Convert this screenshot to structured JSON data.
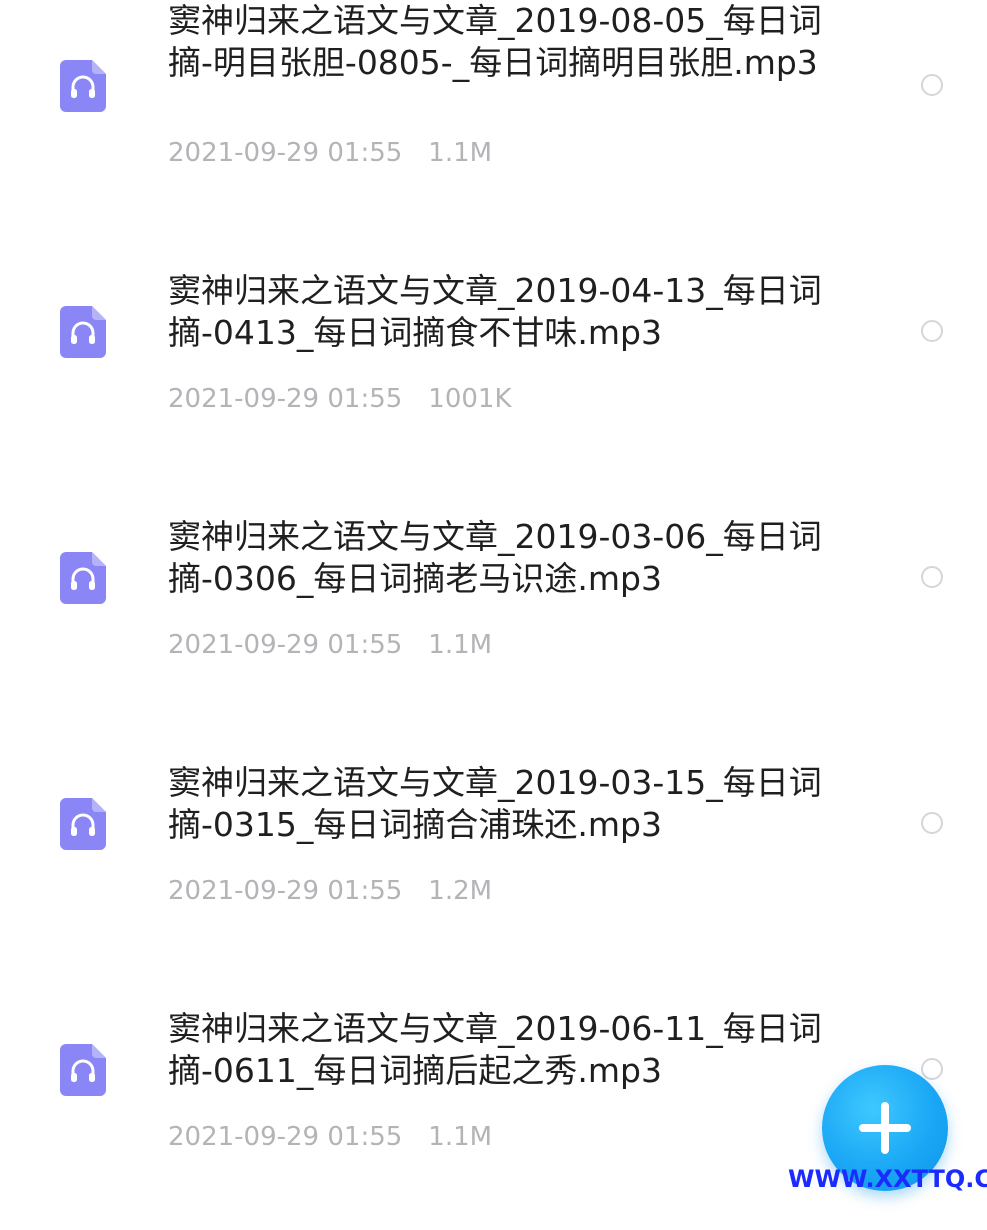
{
  "files": [
    {
      "name": "窦神归来之语文与文章_2019-08-05_每日词摘-明目张胆-0805-_每日词摘明目张胆.mp3",
      "date": "2021-09-29 01:55",
      "size": "1.1M",
      "icon": "audio-file-icon"
    },
    {
      "name": "窦神归来之语文与文章_2019-04-13_每日词摘-0413_每日词摘食不甘味.mp3",
      "date": "2021-09-29 01:55",
      "size": "1001K",
      "icon": "audio-file-icon"
    },
    {
      "name": "窦神归来之语文与文章_2019-03-06_每日词摘-0306_每日词摘老马识途.mp3",
      "date": "2021-09-29 01:55",
      "size": "1.1M",
      "icon": "audio-file-icon"
    },
    {
      "name": "窦神归来之语文与文章_2019-03-15_每日词摘-0315_每日词摘合浦珠还.mp3",
      "date": "2021-09-29 01:55",
      "size": "1.2M",
      "icon": "audio-file-icon"
    },
    {
      "name": "窦神归来之语文与文章_2019-06-11_每日词摘-0611_每日词摘后起之秀.mp3",
      "date": "2021-09-29 01:55",
      "size": "1.1M",
      "icon": "audio-file-icon"
    }
  ],
  "fab": {
    "icon": "plus-icon",
    "color": "#1aa7f5"
  },
  "watermark": {
    "text": "WWW.XXTTQ.COM",
    "color": "#1b2bff"
  },
  "colors": {
    "icon_accent": "#8b86f5",
    "meta_text": "#b4b4b8",
    "name_text": "#1f1f1f"
  }
}
